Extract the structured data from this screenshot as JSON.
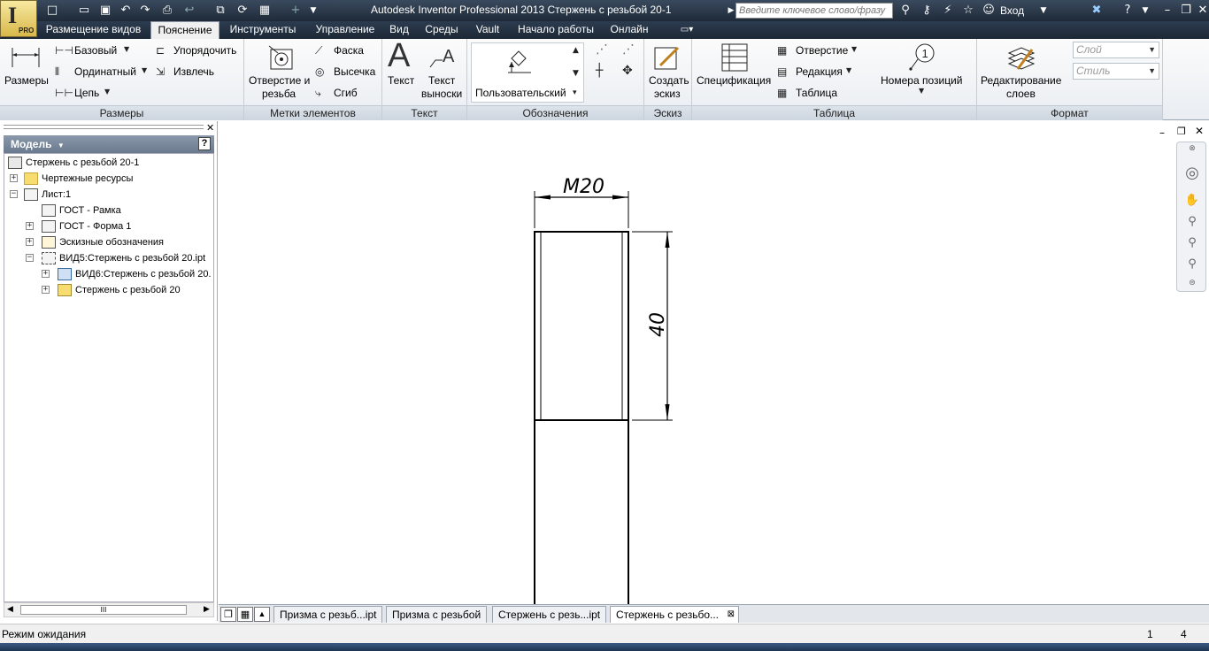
{
  "window": {
    "title": "Autodesk Inventor Professional 2013    Стержень с резьбой 20-1"
  },
  "app": {
    "logo_letter": "I",
    "logo_badge": "PRO"
  },
  "search": {
    "placeholder": "Введите ключевое слово/фразу"
  },
  "user": {
    "login": "Вход"
  },
  "tabs": [
    {
      "label": "Размещение видов"
    },
    {
      "label": "Пояснение"
    },
    {
      "label": "Инструменты"
    },
    {
      "label": "Управление"
    },
    {
      "label": "Вид"
    },
    {
      "label": "Среды"
    },
    {
      "label": "Vault"
    },
    {
      "label": "Начало работы"
    },
    {
      "label": "Онлайн"
    }
  ],
  "ribbon": {
    "dimensions": {
      "title": "Размеры",
      "main_label": "Размеры",
      "baseline": "Базовый",
      "ordinate": "Ординатный",
      "chain": "Цепь",
      "arrange": "Упорядочить",
      "retrieve": "Извлечь"
    },
    "feature_notes": {
      "title": "Метки элементов",
      "hole_thread_line1": "Отверстие и",
      "hole_thread_line2": "резьба",
      "chamfer": "Фаска",
      "punch": "Высечка",
      "bend": "Сгиб"
    },
    "text": {
      "title": "Текст",
      "text_label": "Текст",
      "leader_line1": "Текст",
      "leader_line2": "выноски"
    },
    "symbols": {
      "title": "Обозначения",
      "user_label": "Пользовательский"
    },
    "sketch": {
      "title": "Эскиз",
      "create_line1": "Создать",
      "create_line2": "эскиз"
    },
    "table": {
      "title": "Таблица",
      "parts_list": "Спецификация",
      "hole": "Отверстие",
      "revision": "Редакция",
      "table": "Таблица",
      "balloon": "Номера позиций",
      "balloon_number": "1"
    },
    "format": {
      "title": "Формат",
      "edit_line1": "Редактирование",
      "edit_line2": "слоев",
      "layer_placeholder": "Слой",
      "style_placeholder": "Стиль"
    }
  },
  "browser": {
    "header": "Модель",
    "help": "?",
    "tree": [
      {
        "label": "Стержень с резьбой 20-1"
      },
      {
        "label": "Чертежные ресурсы"
      },
      {
        "label": "Лист:1"
      },
      {
        "label": "ГОСТ - Рамка"
      },
      {
        "label": "ГОСТ - Форма 1"
      },
      {
        "label": "Эскизные обозначения"
      },
      {
        "label": "ВИД5:Стержень с резьбой 20.ipt"
      },
      {
        "label": "ВИД6:Стержень с резьбой 20."
      },
      {
        "label": "Стержень с резьбой 20"
      }
    ],
    "scroll_mark": "III"
  },
  "drawing": {
    "diameter_dim": "M20",
    "length_dim": "40"
  },
  "doc_tabs": [
    {
      "label": "Призма с резьб...ipt"
    },
    {
      "label": "Призма с резьбой"
    },
    {
      "label": "Стержень с резь...ipt"
    },
    {
      "label": "Стержень с резьбо..."
    }
  ],
  "status": {
    "text": "Режим ожидания",
    "count1": "1",
    "count2": "4"
  },
  "colors": {
    "titlebar": "#2d3c50",
    "accent": "#f0f0f0",
    "drawing_line": "#000000"
  }
}
